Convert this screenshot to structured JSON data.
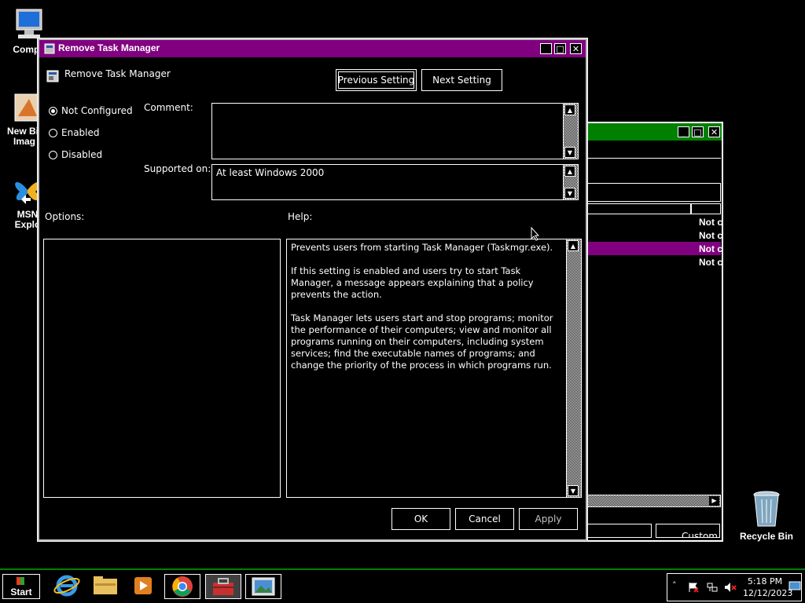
{
  "desktop": {
    "icons": [
      {
        "label_line1": "Compu",
        "label_line2": ""
      },
      {
        "label_line1": "New Bit",
        "label_line2": "Imag"
      },
      {
        "label_line1": "MSN",
        "label_line2": "Explo"
      },
      {
        "label_line1": "Recycle Bin",
        "label_line2": ""
      }
    ]
  },
  "background_window": {
    "list_items": [
      "Not c",
      "Not c",
      "Not c",
      "Not c"
    ],
    "footer_text": "Custom",
    "colors": {
      "titlebar": "#008000",
      "selected_row": "#800080"
    }
  },
  "dialog": {
    "title": "Remove Task Manager",
    "setting_name": "Remove Task Manager",
    "prev_button": "Previous Setting",
    "next_button": "Next Setting",
    "radios": [
      {
        "label": "Not Configured",
        "checked": true
      },
      {
        "label": "Enabled",
        "checked": false
      },
      {
        "label": "Disabled",
        "checked": false
      }
    ],
    "comment_label": "Comment:",
    "comment_value": "",
    "supported_label": "Supported on:",
    "supported_value": "At least Windows 2000",
    "options_label": "Options:",
    "help_label": "Help:",
    "help_paragraphs": [
      "Prevents users from starting Task Manager (Taskmgr.exe).",
      "If this setting is enabled and users try to start Task Manager, a message appears explaining that a policy prevents the action.",
      "Task Manager lets users start and stop programs; monitor the performance of their computers; view and monitor all programs running on their computers, including system services; find the executable names of programs; and change the priority of the process in which programs run."
    ],
    "ok_button": "OK",
    "cancel_button": "Cancel",
    "apply_button": "Apply",
    "colors": {
      "titlebar": "#800080"
    }
  },
  "taskbar": {
    "start_label": "Start",
    "apps": [
      "internet-explorer-icon",
      "file-explorer-icon",
      "media-player-icon",
      "chrome-icon",
      "toolbox-icon",
      "image-viewer-icon"
    ],
    "clock_time": "5:18 PM",
    "clock_date": "12/12/2023",
    "border_color": "#008000"
  }
}
